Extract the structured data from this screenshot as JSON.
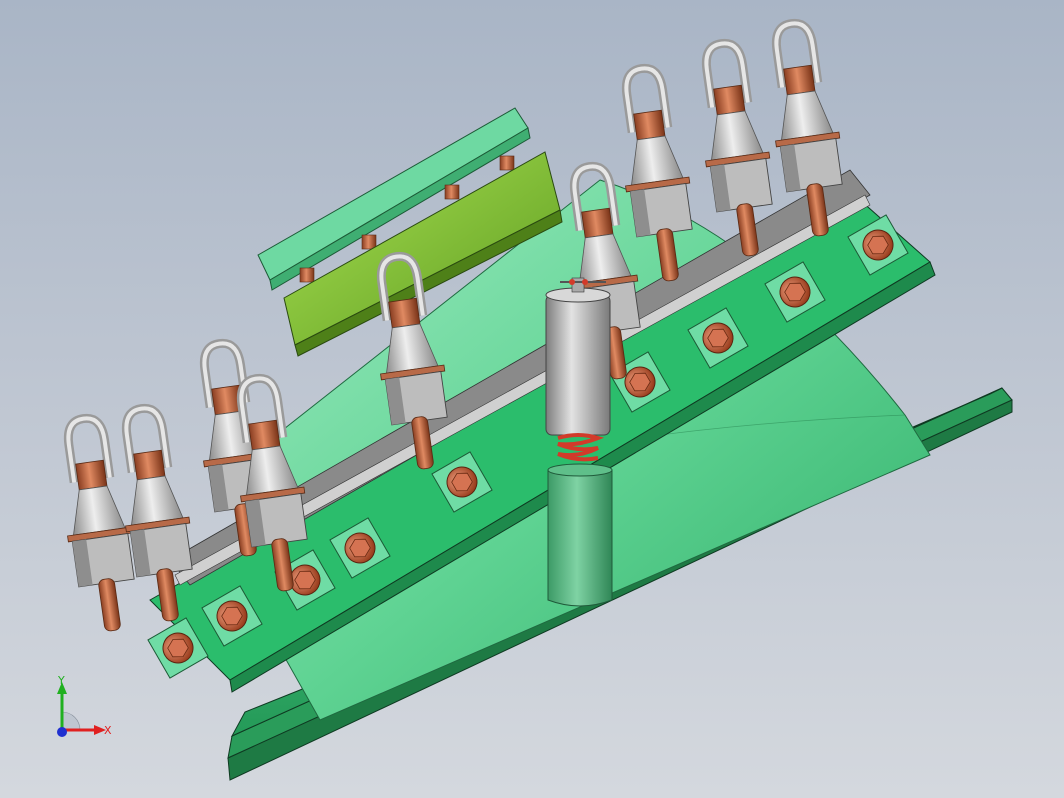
{
  "viewport": {
    "background_top": "#a9b5c6",
    "background_bottom": "#d4d8de"
  },
  "model": {
    "colors": {
      "body_green": "#3ec97a",
      "body_green_light": "#7fe0ab",
      "body_green_dark": "#2a9a5c",
      "plate_green": "#6ed9a2",
      "board_green": "#8ccf3a",
      "board_green_dark": "#5f9a22",
      "copper": "#c86a45",
      "copper_dark": "#8a3e22",
      "steel": "#c9c9c9",
      "steel_dark": "#8f8f8f",
      "spring_red": "#d23a2a"
    }
  },
  "triad": {
    "x_label": "X",
    "y_label": "Y",
    "x_color": "#e02020",
    "y_color": "#20b020",
    "z_color": "#2030d0"
  }
}
